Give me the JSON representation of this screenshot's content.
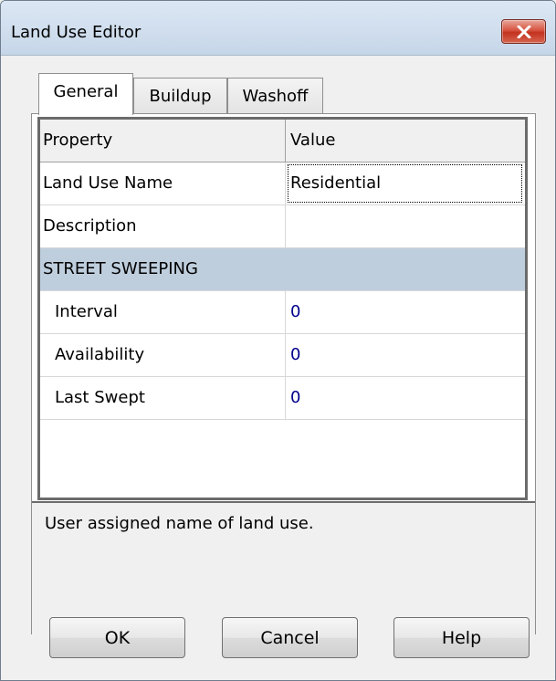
{
  "window": {
    "title": "Land Use Editor",
    "close_icon": "close-icon"
  },
  "tabs": [
    {
      "label": "General",
      "active": true
    },
    {
      "label": "Buildup",
      "active": false
    },
    {
      "label": "Washoff",
      "active": false
    }
  ],
  "grid": {
    "headers": {
      "property": "Property",
      "value": "Value"
    },
    "rows": [
      {
        "property": "Land Use Name",
        "value": "Residential"
      },
      {
        "property": "Description",
        "value": ""
      },
      {
        "property": "STREET SWEEPING",
        "value": ""
      },
      {
        "property": "Interval",
        "value": "0"
      },
      {
        "property": "Availability",
        "value": "0"
      },
      {
        "property": "Last Swept",
        "value": "0"
      }
    ]
  },
  "description": "User assigned name of land use.",
  "buttons": {
    "ok": "OK",
    "cancel": "Cancel",
    "help": "Help"
  },
  "colors": {
    "section_background": "#bfcedd",
    "numeric_value": "#00008b",
    "close_button": "#c3321f"
  }
}
